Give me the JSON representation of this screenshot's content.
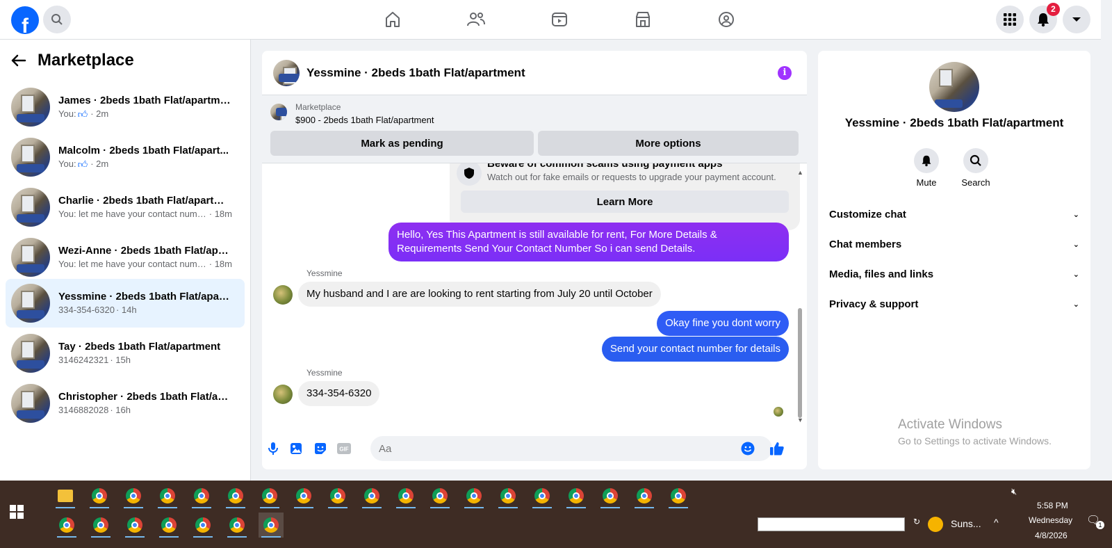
{
  "topbar": {
    "logo": "f",
    "notification_count": "2",
    "nav_icons": [
      "home-icon",
      "friends-icon",
      "video-icon",
      "marketplace-icon",
      "groups-icon"
    ]
  },
  "sidebar": {
    "title": "Marketplace",
    "conversations": [
      {
        "name": "James · 2beds 1bath Flat/apartment",
        "prefix": "You:",
        "like": true,
        "time": "· 2m",
        "sub": ""
      },
      {
        "name": "Malcolm · 2beds 1bath Flat/apart...",
        "prefix": "You:",
        "like": true,
        "time": "· 2m",
        "sub": ""
      },
      {
        "name": "Charlie · 2beds 1bath Flat/apartment",
        "prefix": "",
        "like": false,
        "time": "· 18m",
        "sub": "You: let me have your contact numb..."
      },
      {
        "name": "Wezi-Anne · 2beds 1bath Flat/apar...",
        "prefix": "",
        "like": false,
        "time": "· 18m",
        "sub": "You: let me have your contact numb..."
      },
      {
        "name": "Yessmine · 2beds 1bath Flat/apart...",
        "prefix": "",
        "like": false,
        "time": "· 14h",
        "sub": "334-354-6320"
      },
      {
        "name": "Tay · 2beds 1bath Flat/apartment",
        "prefix": "",
        "like": false,
        "time": "· 15h",
        "sub": "3146242321"
      },
      {
        "name": "Christopher · 2beds 1bath Flat/apa...",
        "prefix": "",
        "like": false,
        "time": "· 16h",
        "sub": "3146882028"
      }
    ]
  },
  "chat": {
    "title": "Yessmine · 2beds 1bath Flat/apartment",
    "listing_source": "Marketplace",
    "listing_price": "$900 - 2beds 1bath Flat/apartment",
    "mark_pending": "Mark as pending",
    "more_options": "More options",
    "scam_title": "Beware of common scams using payment apps",
    "scam_desc": "Watch out for fake emails or requests to upgrade your payment account.",
    "learn_more": "Learn More",
    "msg_out_1": "Hello, Yes This Apartment is still available for rent, For More Details & Requirements Send Your Contact Number So i can send Details.",
    "sender_1": "Yessmine",
    "msg_in_1": "My husband and I are are looking to rent starting from July 20 until October",
    "msg_out_2": "Okay fine you dont worry",
    "msg_out_3": "Send your contact number for details",
    "sender_2": "Yessmine",
    "msg_in_2": "334-354-6320",
    "input_placeholder": "Aa",
    "colors": {
      "purple": "#8a2be2",
      "blue": "#1d6ff2",
      "accent": "#a033ff"
    }
  },
  "right_panel": {
    "name": "Yessmine · 2beds 1bath Flat/apartment",
    "mute": "Mute",
    "search": "Search",
    "sections": [
      "Customize chat",
      "Chat members",
      "Media, files and links",
      "Privacy & support"
    ],
    "activate_title": "Activate Windows",
    "activate_sub": "Go to Settings to activate Windows."
  },
  "taskbar": {
    "time": "5:58 PM",
    "day": "Wednesday",
    "date": "4/8/2026",
    "weather": "Suns...",
    "notif_count": "1"
  }
}
